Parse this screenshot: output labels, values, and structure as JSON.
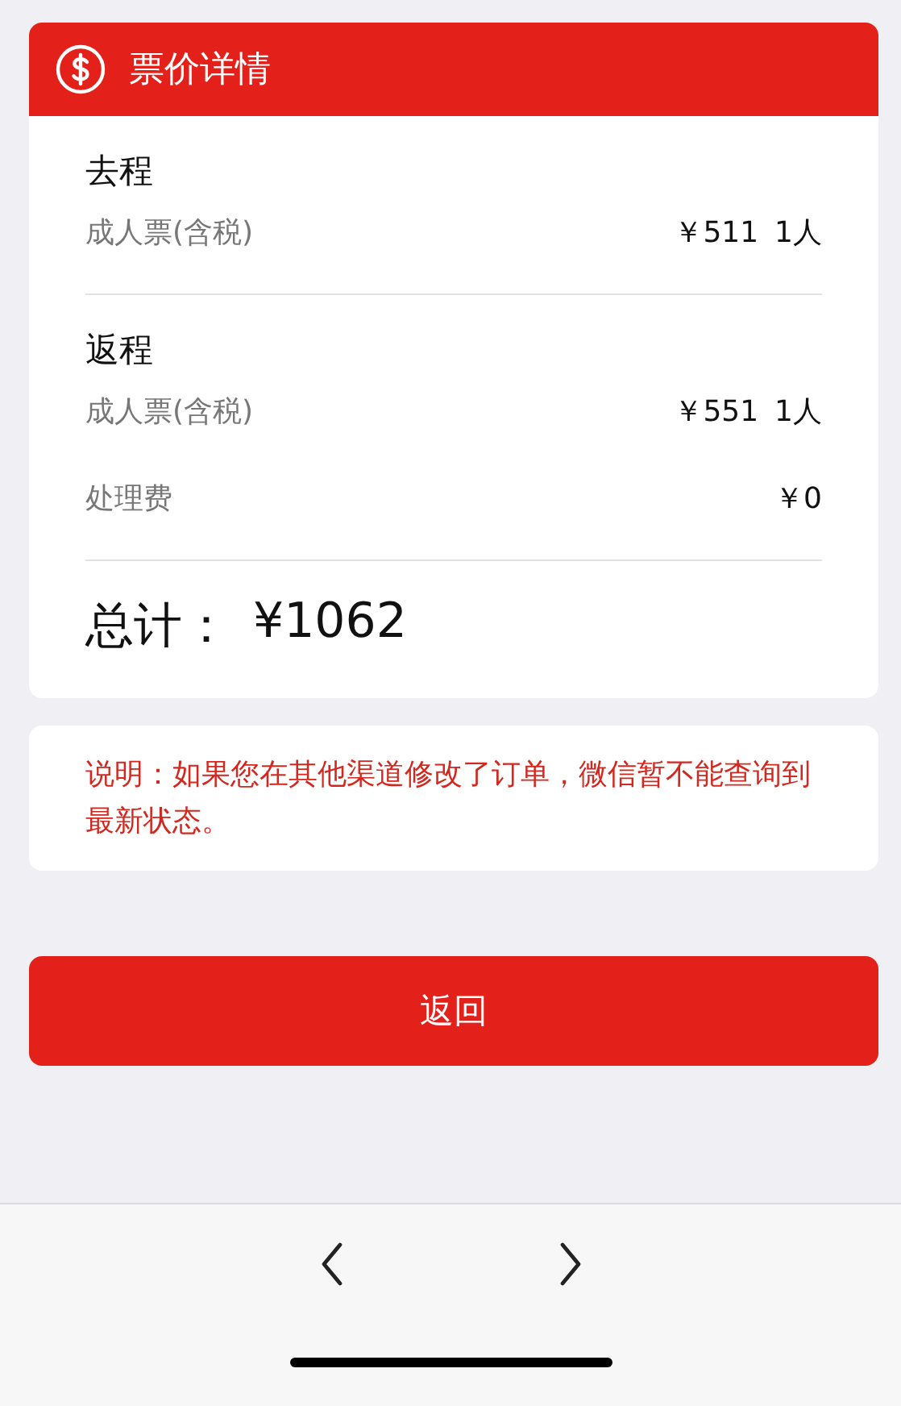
{
  "header": {
    "title": "票价详情"
  },
  "trips": [
    {
      "title": "去程",
      "label": "成人票(含税)",
      "price": "￥511",
      "count": "1人"
    },
    {
      "title": "返程",
      "label": "成人票(含税)",
      "price": "￥551",
      "count": "1人"
    }
  ],
  "fee": {
    "label": "处理费",
    "price": "￥0"
  },
  "total": {
    "label": "总计：",
    "amount": "¥1062"
  },
  "note": "说明：如果您在其他渠道修改了订单，微信暂不能查询到最新状态。",
  "button": "返回"
}
